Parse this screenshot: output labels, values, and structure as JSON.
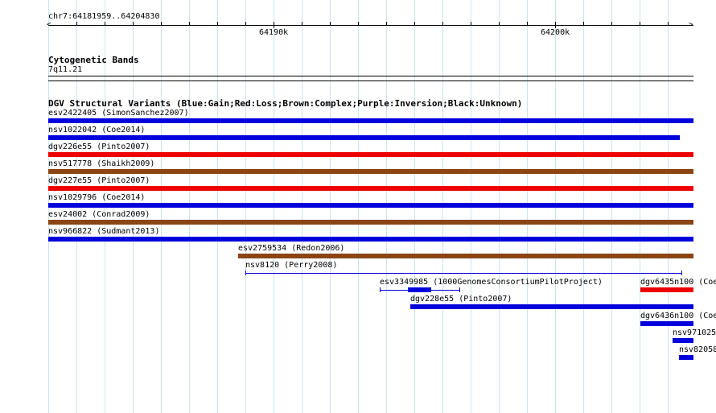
{
  "ruler": {
    "position_label": "chr7:64181959..64204830",
    "major_labels": [
      "64190k",
      "64200k"
    ]
  },
  "cytogenetic": {
    "title": "Cytogenetic Bands",
    "band": "7q11.21"
  },
  "dgv": {
    "title": "DGV Structural Variants (Blue:Gain;Red:Loss;Brown:Complex;Purple:Inversion;Black:Unknown)",
    "colors": {
      "gain": "#0000dd",
      "loss": "#ee0000",
      "complex": "#8b4513"
    },
    "features": [
      {
        "label": "esv2422405 (SimonSanchez2007)",
        "type": "gain"
      },
      {
        "label": "nsv1022042 (Coe2014)",
        "type": "gain"
      },
      {
        "label": "dgv226e55 (Pinto2007)",
        "type": "loss"
      },
      {
        "label": "nsv517778 (Shaikh2009)",
        "type": "complex"
      },
      {
        "label": "dgv227e55 (Pinto2007)",
        "type": "loss"
      },
      {
        "label": "nsv1029796 (Coe2014)",
        "type": "gain"
      },
      {
        "label": "esv24002 (Conrad2009)",
        "type": "complex"
      },
      {
        "label": "nsv966822 (Sudmant2013)",
        "type": "gain"
      },
      {
        "label": "esv2759534 (Redon2006)",
        "type": "complex"
      },
      {
        "label": "nsv8120 (Perry2008)",
        "type": "gain"
      },
      {
        "label": "esv3349985 (1000GenomesConsortiumPilotProject)",
        "type": "gain"
      },
      {
        "label": "dgv228e55 (Pinto2007)",
        "type": "gain"
      },
      {
        "label": "dgv6435n100 (Coe",
        "type": "loss"
      },
      {
        "label": "dgv6436n100 (Coe",
        "type": "gain"
      },
      {
        "label": "nsv971025",
        "type": "gain"
      },
      {
        "label": "nsv82058",
        "type": "gain"
      }
    ]
  }
}
